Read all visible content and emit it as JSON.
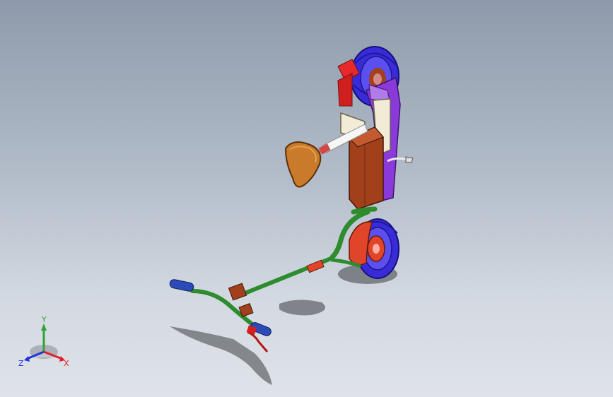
{
  "viewport": {
    "background_top": "#8e9aab",
    "background_bottom": "#dfe3e9"
  },
  "triad": {
    "x_label": "X",
    "y_label": "Y",
    "z_label": "Z",
    "x_color": "#e0202a",
    "y_color": "#2fa336",
    "z_color": "#2234d6"
  },
  "model": {
    "wheel_tire_color": "#3a2bd8",
    "hub_color": "#e0452a",
    "frame_color": "#2e8b2e",
    "seat_color": "#c97a2a",
    "deck_color": "#a2401c",
    "panel_color": "#f2ecd6",
    "grip_color": "#2c4bb8",
    "fender_color": "#d42020",
    "motor_color": "#8a3ad8"
  }
}
